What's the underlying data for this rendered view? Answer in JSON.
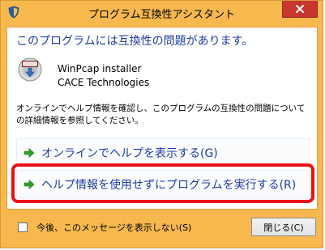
{
  "window": {
    "title": "プログラム互換性アシスタント",
    "close_glyph": "✕"
  },
  "main": {
    "heading": "このプログラムには互換性の問題があります。",
    "program_name": "WinPcap installer",
    "company": "CACE Technologies",
    "description": "オンラインでヘルプ情報を確認し、このプログラムの互換性の問題についての詳細情報を参照してください。",
    "options": [
      {
        "label": "オンラインでヘルプを表示する(G)"
      },
      {
        "label": "ヘルプ情報を使用せずにプログラムを実行する(R)"
      }
    ]
  },
  "footer": {
    "checkbox_label": "今後、このメッセージを表示しない(S)",
    "close_button": "閉じる(C)"
  },
  "colors": {
    "accent_blue": "#1c3ca6",
    "highlight_red": "#e8111a",
    "title_orange": "#f7b84d",
    "close_red": "#c7372d",
    "arrow_green": "#2ba12b"
  },
  "icons": {
    "app": "shield-icon",
    "program": "installer-disc-icon",
    "option_arrow": "green-arrow-right-icon",
    "close": "close-icon"
  }
}
